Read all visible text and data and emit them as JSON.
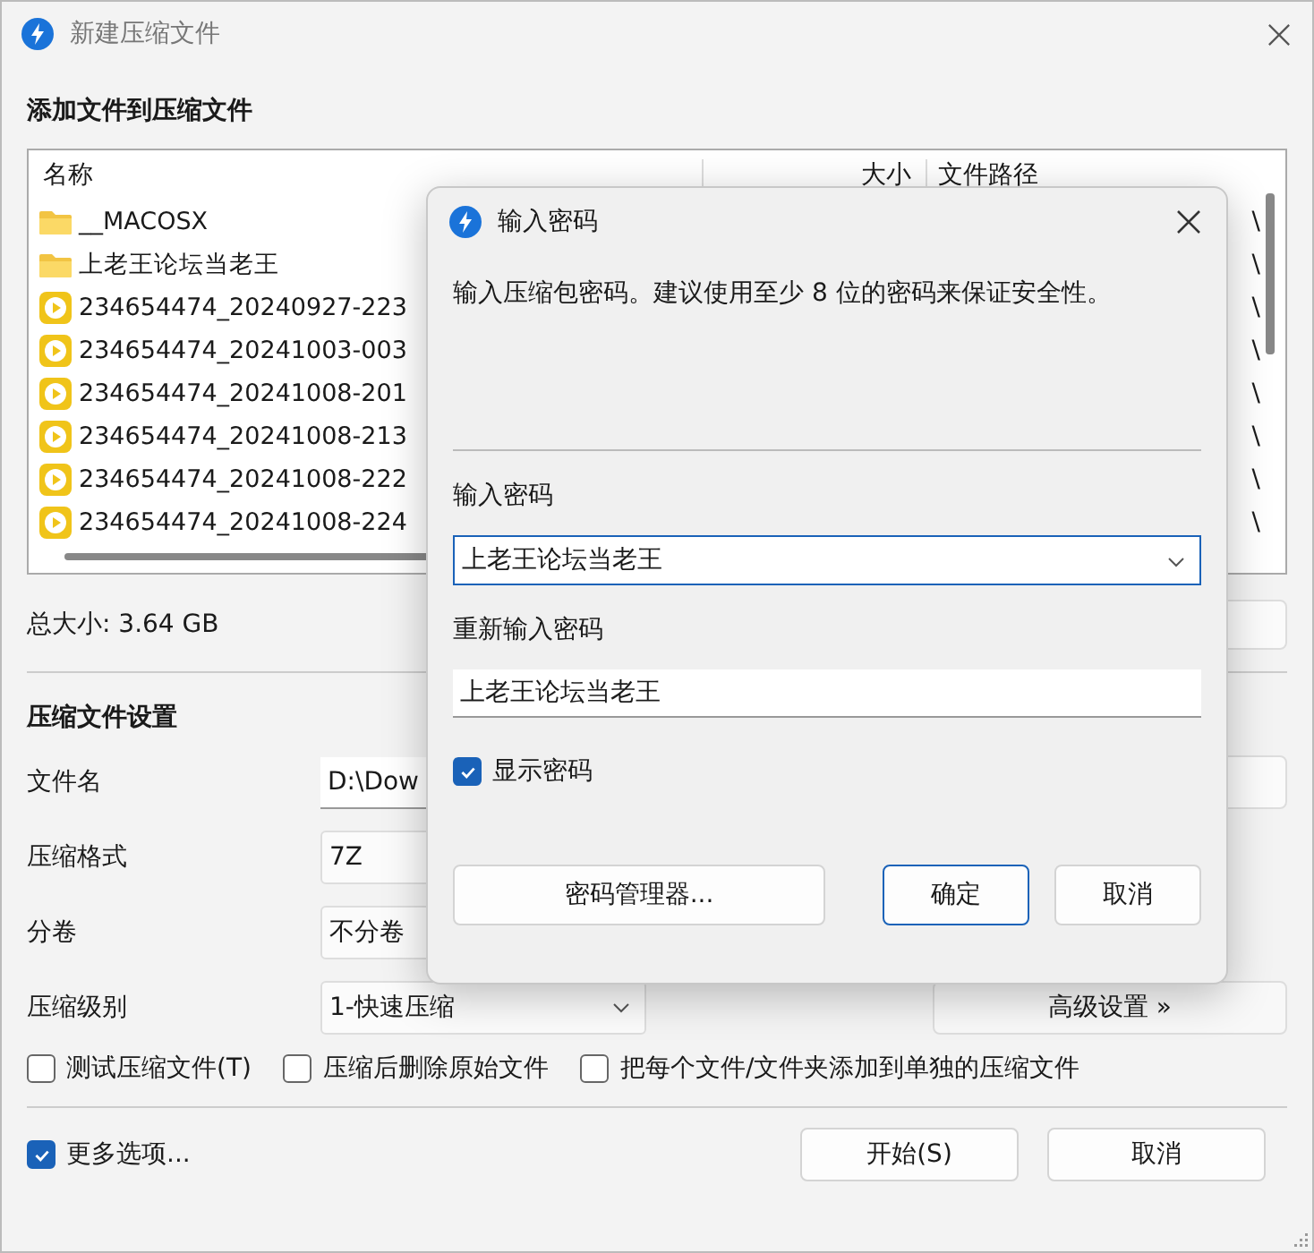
{
  "window": {
    "title": "新建压缩文件"
  },
  "files_heading": "添加文件到压缩文件",
  "file_list": {
    "columns": [
      "名称",
      "大小",
      "文件路径"
    ],
    "rows": [
      {
        "kind": "folder",
        "name": "__MACOSX",
        "path": "\\"
      },
      {
        "kind": "folder",
        "name": "上老王论坛当老王",
        "path": "\\"
      },
      {
        "kind": "video",
        "name": "234654474_20240927-223",
        "path": "\\"
      },
      {
        "kind": "video",
        "name": "234654474_20241003-003",
        "path": "\\"
      },
      {
        "kind": "video",
        "name": "234654474_20241008-201",
        "path": "\\"
      },
      {
        "kind": "video",
        "name": "234654474_20241008-213",
        "path": "\\"
      },
      {
        "kind": "video",
        "name": "234654474_20241008-222",
        "path": "\\"
      },
      {
        "kind": "video",
        "name": "234654474_20241008-224",
        "path": "\\"
      }
    ]
  },
  "total_size": "总大小: 3.64 GB",
  "settings_heading": "压缩文件设置",
  "settings": [
    {
      "kind": "field",
      "label": "文件名",
      "value": "D:\\Dow"
    },
    {
      "kind": "select",
      "label": "压缩格式",
      "value": "7Z"
    },
    {
      "kind": "select",
      "label": "分卷",
      "value": "不分卷"
    },
    {
      "kind": "dropdown",
      "label": "压缩级别",
      "value": "1-快速压缩"
    }
  ],
  "advanced_button": "高级设置 »",
  "options": [
    {
      "label": "测试压缩文件(T)",
      "checked": false
    },
    {
      "label": "压缩后删除原始文件",
      "checked": false
    },
    {
      "label": "把每个文件/文件夹添加到单独的压缩文件",
      "checked": false
    }
  ],
  "more_options": {
    "label": "更多选项...",
    "checked": true
  },
  "buttons": [
    "开始(S)",
    "取消"
  ],
  "password_dialog": {
    "title": "输入密码",
    "description": "输入压缩包密码。建议使用至少 8 位的密码来保证安全性。",
    "password_label": "输入密码",
    "password_value": "上老王论坛当老王",
    "confirm_label": "重新输入密码",
    "confirm_value": "上老王论坛当老王",
    "show_password": {
      "label": "显示密码",
      "checked": true
    },
    "manager_button": "密码管理器...",
    "buttons": [
      "确定",
      "取消"
    ]
  }
}
